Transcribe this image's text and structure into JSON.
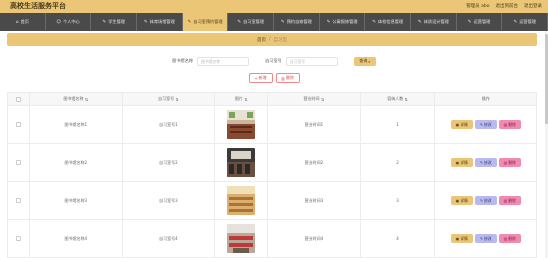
{
  "header": {
    "title": "高校生活服务平台",
    "user_label": "管理员 abo",
    "back_link": "退出到前台",
    "logout_link": "退出登录"
  },
  "nav": {
    "items": [
      {
        "icon": "home-icon",
        "glyph": "⌂",
        "label": "首页"
      },
      {
        "icon": "user-icon",
        "glyph": "☺",
        "label": "个人中心"
      },
      {
        "icon": "edit-icon",
        "glyph": "✎",
        "label": "学生管理"
      },
      {
        "icon": "edit-icon",
        "glyph": "✎",
        "label": "体育场馆管理"
      },
      {
        "icon": "edit-icon",
        "glyph": "✎",
        "label": "自习室预约管理"
      },
      {
        "icon": "edit-icon",
        "glyph": "✎",
        "label": "自习室管理"
      },
      {
        "icon": "edit-icon",
        "glyph": "✎",
        "label": "预约自修管理"
      },
      {
        "icon": "edit-icon",
        "glyph": "✎",
        "label": "公寓报修管理"
      },
      {
        "icon": "edit-icon",
        "glyph": "✎",
        "label": "体检信息管理"
      },
      {
        "icon": "edit-icon",
        "glyph": "✎",
        "label": "体质设计管理"
      },
      {
        "icon": "edit-icon",
        "glyph": "✎",
        "label": "运营管理"
      },
      {
        "icon": "edit-icon",
        "glyph": "✎",
        "label": "运营管理"
      }
    ],
    "active_index": 4
  },
  "breadcrumb": {
    "home": "首页",
    "separator": "/",
    "current": "自习室"
  },
  "search": {
    "field1_label": "图书馆名称",
    "field1_placeholder": "图书馆名称",
    "field2_label": "自习室号",
    "field2_placeholder": "自习室号",
    "button_label": "查询"
  },
  "actions": {
    "add_label": "新增",
    "delete_label": "删除"
  },
  "table": {
    "headers": [
      "图书馆名称",
      "自习室号",
      "图片",
      "营业时间",
      "容纳人数",
      "操作"
    ],
    "rows": [
      {
        "name": "图书馆名称1",
        "room": "自习室号1",
        "hours": "营业时间1",
        "capacity": "1"
      },
      {
        "name": "图书馆名称2",
        "room": "自习室号2",
        "hours": "营业时间2",
        "capacity": "2"
      },
      {
        "name": "图书馆名称3",
        "room": "自习室号3",
        "hours": "营业时间3",
        "capacity": "3"
      },
      {
        "name": "图书馆名称4",
        "room": "自习室号4",
        "hours": "营业时间4",
        "capacity": "4"
      }
    ],
    "op_labels": {
      "detail": "详情",
      "edit": "修改",
      "delete": "删除"
    }
  },
  "colors": {
    "accent": "#ebc676",
    "nav_bg": "#4a4a4a",
    "edit": "#b9b9ec",
    "delete": "#f08ab0"
  }
}
